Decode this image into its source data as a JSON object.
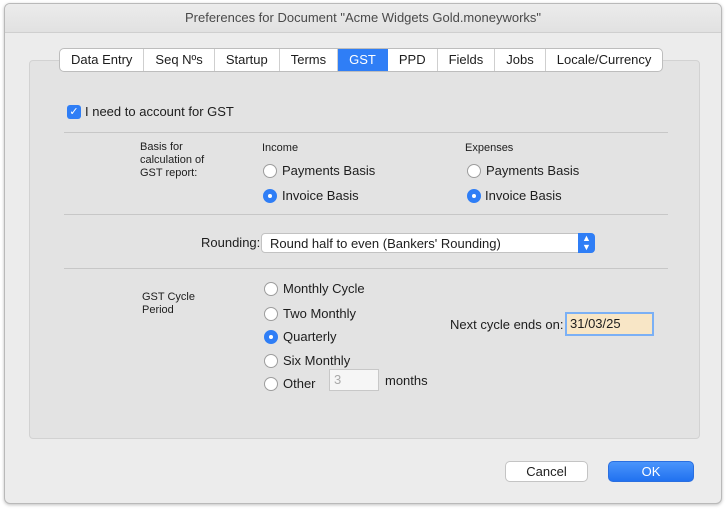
{
  "window": {
    "title": "Preferences for Document \"Acme Widgets Gold.moneyworks\""
  },
  "tabs": [
    {
      "label": "Data Entry",
      "active": false
    },
    {
      "label": "Seq Nºs",
      "active": false
    },
    {
      "label": "Startup",
      "active": false
    },
    {
      "label": "Terms",
      "active": false
    },
    {
      "label": "GST",
      "active": true
    },
    {
      "label": "PPD",
      "active": false
    },
    {
      "label": "Fields",
      "active": false
    },
    {
      "label": "Jobs",
      "active": false
    },
    {
      "label": "Locale/Currency",
      "active": false
    }
  ],
  "gst": {
    "account_checkbox": {
      "label": "I need to account for GST",
      "checked": true
    },
    "basis": {
      "label": "Basis for calculation of GST report:",
      "income": {
        "header": "Income",
        "payments": "Payments Basis",
        "invoice": "Invoice Basis",
        "selected": "invoice"
      },
      "expenses": {
        "header": "Expenses",
        "payments": "Payments Basis",
        "invoice": "Invoice Basis",
        "selected": "invoice"
      }
    },
    "rounding": {
      "label": "Rounding:",
      "value": "Round half to even (Bankers' Rounding)"
    },
    "cycle": {
      "label": "GST Cycle Period",
      "options": {
        "monthly": "Monthly Cycle",
        "two_monthly": "Two Monthly",
        "quarterly": "Quarterly",
        "six_monthly": "Six Monthly",
        "other": "Other"
      },
      "selected": "quarterly",
      "other_value": "3",
      "months_label": "months",
      "next_cycle_label": "Next cycle ends on:",
      "next_cycle_value": "31/03/25"
    }
  },
  "buttons": {
    "cancel": "Cancel",
    "ok": "OK"
  },
  "colors": {
    "accent": "#2f7ef6",
    "date_field_bg": "#f8e6c6"
  }
}
